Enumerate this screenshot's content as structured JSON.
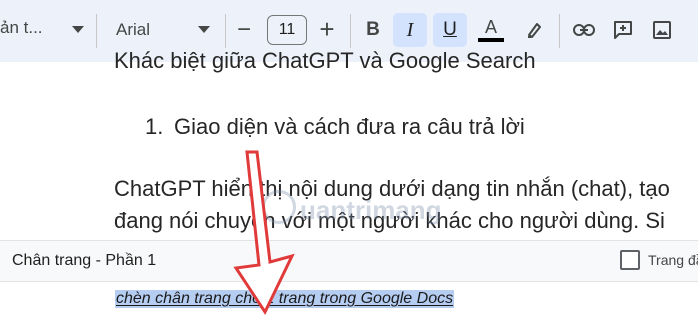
{
  "toolbar": {
    "paragraph_style": "ản t...",
    "font_name": "Arial",
    "font_size": "11",
    "decrease_symbol": "−",
    "increase_symbol": "+",
    "bold_label": "B",
    "italic_label": "I",
    "underline_label": "U",
    "text_color_label": "A",
    "icons": [
      "chevron-down-icon",
      "minus-icon",
      "plus-icon",
      "bold-icon",
      "italic-icon",
      "underline-icon",
      "text-color-icon",
      "highlighter-icon",
      "link-icon",
      "add-comment-icon",
      "image-icon"
    ],
    "active_color": "#d3e3fd"
  },
  "document": {
    "heading_top": "Khác biệt giữa ChatGPT và Google Search",
    "list_item_number": "1.",
    "list_item_text": "Giao diện và cách đưa ra câu trả lời",
    "para_line1": "ChatGPT hiển thị nội dung dưới dạng tin nhắn (chat), tạo",
    "para_line2": "đang nói chuyện với một người khác cho người dùng. Si"
  },
  "footer": {
    "section_title": "Chân trang - Phần 1",
    "checkbox_label": "Trang đầ",
    "checkbox_checked": false,
    "footer_text": "chèn chân trang cho 1 trang trong Google Docs"
  },
  "watermark_text": "uantrimang",
  "annotation_color": "#e03a3a"
}
